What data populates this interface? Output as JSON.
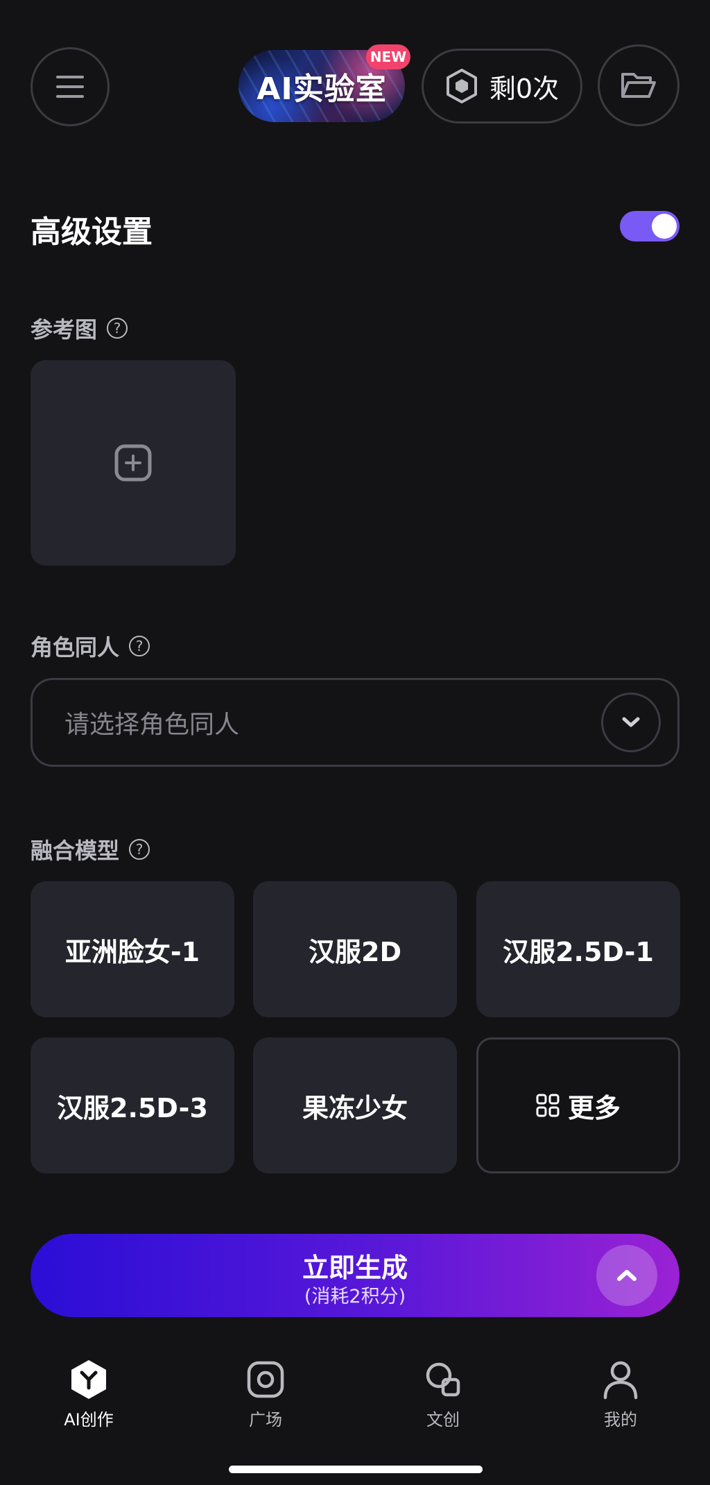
{
  "header": {
    "lab_label": "AI实验室",
    "new_badge": "NEW",
    "remaining_label": "剩0次"
  },
  "advanced": {
    "title": "高级设置",
    "toggle_on": true
  },
  "reference": {
    "label": "参考图",
    "help": "?"
  },
  "character": {
    "label": "角色同人",
    "help": "?",
    "placeholder": "请选择角色同人"
  },
  "models": {
    "label": "融合模型",
    "help": "?",
    "items": [
      "亚洲脸女-1",
      "汉服2D",
      "汉服2.5D-1",
      "汉服2.5D-3",
      "果冻少女"
    ],
    "more_label": "更多"
  },
  "generate": {
    "title": "立即生成",
    "subtitle": "(消耗2积分)"
  },
  "tabbar": {
    "items": [
      "AI创作",
      "广场",
      "文创",
      "我的"
    ]
  },
  "colors": {
    "background": "#131215",
    "accent": "#7a5af5",
    "card": "#25252d",
    "gradient_start": "#2b0ed6",
    "gradient_end": "#9a22d4"
  }
}
